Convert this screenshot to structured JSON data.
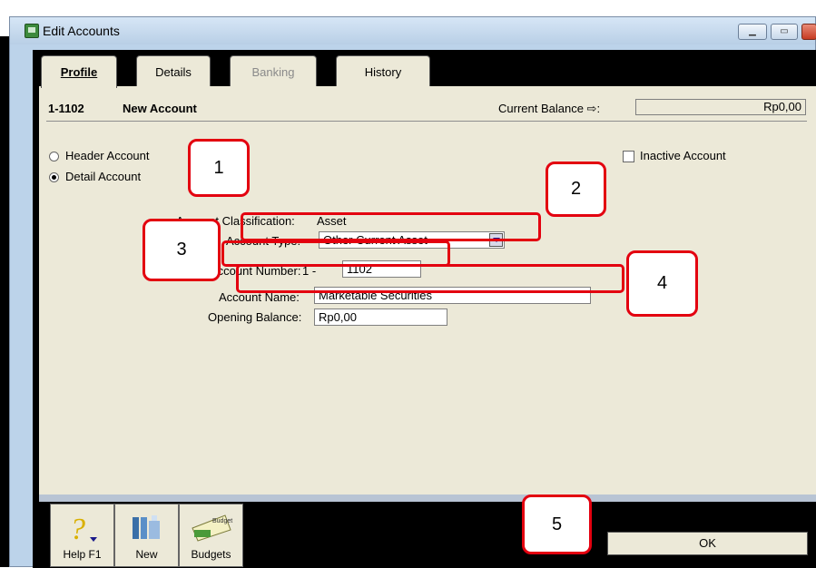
{
  "window": {
    "title": "Edit Accounts",
    "controls": [
      "minimize",
      "maximize",
      "close"
    ]
  },
  "tabs": [
    {
      "label": "Profile",
      "active": true
    },
    {
      "label": "Details",
      "active": false
    },
    {
      "label": "Banking",
      "active": false,
      "disabled": true
    },
    {
      "label": "History",
      "active": false
    }
  ],
  "account": {
    "code": "1-1102",
    "title": "New Account"
  },
  "current_balance": {
    "label": "Current Balance ⇨:",
    "value": "Rp0,00"
  },
  "account_kind": {
    "header_label": "Header Account",
    "detail_label": "Detail Account",
    "selected": "detail"
  },
  "inactive": {
    "label": "Inactive Account",
    "checked": false
  },
  "classification": {
    "label": "Account Classification:",
    "value": "Asset"
  },
  "account_type": {
    "label": "Account Type:",
    "value": "Other Current Asset"
  },
  "account_number": {
    "label": "Account Number:",
    "prefix": "1 -",
    "value": "1102"
  },
  "account_name": {
    "label": "Account Name:",
    "value": "Marketable Securities"
  },
  "opening_balance": {
    "label": "Opening Balance:",
    "value": "Rp0,00"
  },
  "toolbar": {
    "help": "Help F1",
    "new": "New",
    "budgets": "Budgets",
    "budget_icon_text": "Budget"
  },
  "ok_label": "OK",
  "callouts": [
    "1",
    "2",
    "3",
    "4",
    "5"
  ],
  "colors": {
    "callout_border": "#e3000f",
    "dialog_bg": "#ece9d8",
    "title_bar": "#bcd3ea"
  }
}
